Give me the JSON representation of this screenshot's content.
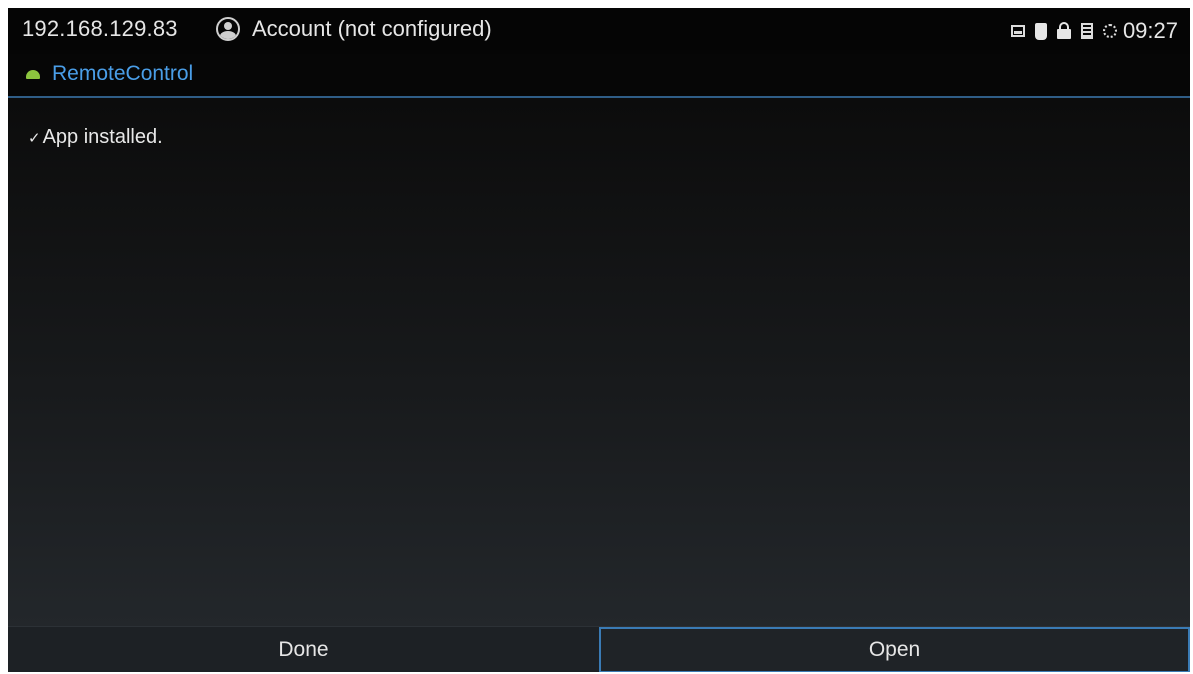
{
  "status_bar": {
    "ip_address": "192.168.129.83",
    "account_label": "Account (not configured)",
    "account_icon": "account-circle-icon",
    "icons": [
      "image-icon",
      "usb-icon",
      "lock-icon",
      "sd-card-icon",
      "sync-icon"
    ],
    "time": "09:27"
  },
  "title_bar": {
    "app_icon": "android-icon",
    "app_name": "RemoteControl"
  },
  "content": {
    "check_glyph": "✓",
    "message": "App installed."
  },
  "buttons": {
    "done_label": "Done",
    "open_label": "Open"
  },
  "colors": {
    "accent": "#3a7bb5",
    "title_text": "#4a9ee8",
    "android_green": "#8cc43e"
  }
}
